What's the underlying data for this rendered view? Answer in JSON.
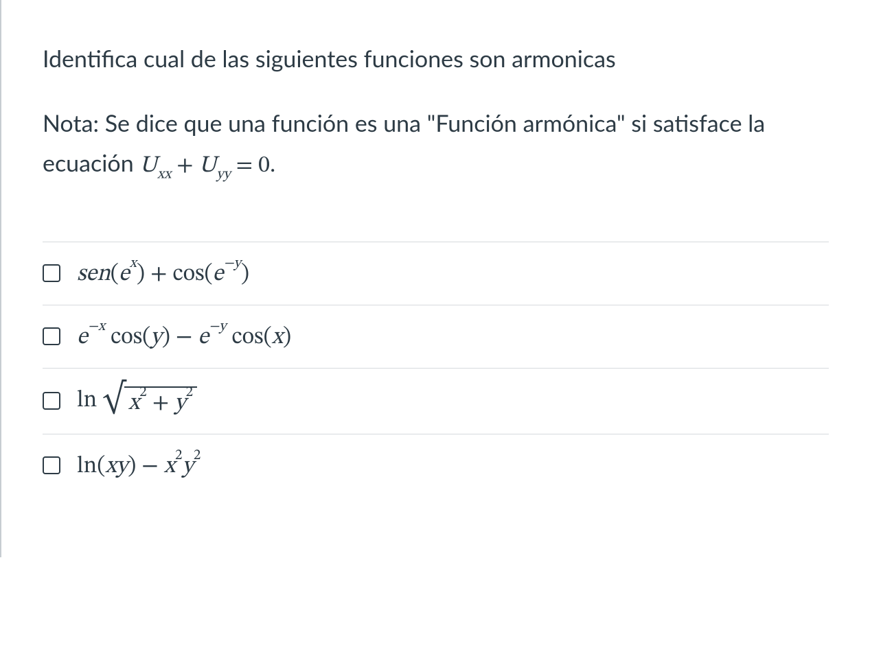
{
  "prompt": "Identifica cual de las siguientes funciones son armonicas",
  "note": {
    "prefix": "Nota: Se dice que una función es una \"Función armónica\" si satisface la ecuación ",
    "equation_html": "<span class=\"math\">U<sub>xx</sub><span class=\"op\">+</span>U<sub>yy</sub><span class=\"op\">=</span><span class=\"rm\">0</span><span class=\"rm\">.</span></span>"
  },
  "options": [
    {
      "html": "<span class=\"math\">sen<span class=\"rm\">(</span>e<sup>x</sup><span class=\"rm\">)</span><span class=\"op\">+</span><span class=\"fn\">cos</span><span class=\"rm\">(</span>e<sup>−y</sup><span class=\"rm\">)</span></span>"
    },
    {
      "html": "<span class=\"math\">e<sup>−x</sup>&nbsp;<span class=\"fn\">cos</span><span class=\"rm\">(</span>y<span class=\"rm\">)</span><span class=\"op\">−</span>e<sup>−y</sup>&nbsp;<span class=\"fn\">cos</span><span class=\"rm\">(</span>x<span class=\"rm\">)</span></span>"
    },
    {
      "html": "<span class=\"math\"><span class=\"fn\">ln</span>&nbsp;<span class=\"sqrt\"><span class=\"surd\">√</span><span class=\"rad\">x<sup><span class=\"rm\">2</span></sup><span class=\"op\">+</span>y<sup><span class=\"rm\">2</span></sup></span></span></span>"
    },
    {
      "html": "<span class=\"math\"><span class=\"fn\">ln</span><span class=\"rm\">(</span>xy<span class=\"rm\">)</span><span class=\"op\">−</span>x<sup><span class=\"rm\">2</span></sup>y<sup><span class=\"rm\">2</span></sup></span>"
    }
  ]
}
